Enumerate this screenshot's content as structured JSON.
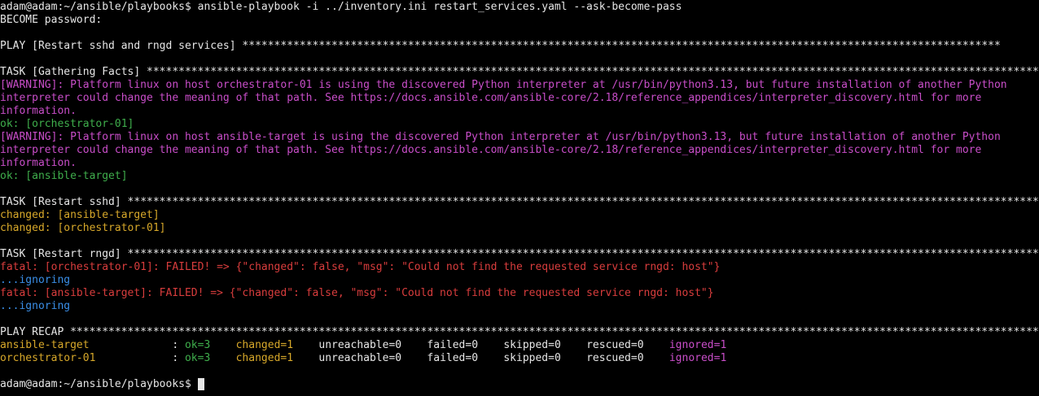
{
  "terminal": {
    "colors": {
      "background": "#000000",
      "default": "#e6e6e6",
      "warning": "#c94ec9",
      "ok": "#3fae4c",
      "changed": "#d7a82a",
      "fatal": "#d93d3d",
      "ignoring": "#3a8ee6"
    },
    "lines": [
      [
        {
          "t": "adam@adam:~/ansible/playbooks$ ansible-playbook -i ../inventory.ini restart_services.yaml --ask-become-pass",
          "c": "default"
        }
      ],
      [
        {
          "t": "BECOME password:",
          "c": "default"
        }
      ],
      [],
      [
        {
          "t": "PLAY [Restart sshd and rngd services] ",
          "c": "default"
        },
        {
          "t": "***********************************************************************************************************************",
          "c": "default"
        }
      ],
      [],
      [
        {
          "t": "TASK [Gathering Facts] ",
          "c": "default"
        },
        {
          "t": "*********************************************************************************************************************************************",
          "c": "default"
        }
      ],
      [
        {
          "t": "[WARNING]: Platform linux on host orchestrator-01 is using the discovered Python interpreter at /usr/bin/python3.13, but future installation of another Python",
          "c": "magenta"
        }
      ],
      [
        {
          "t": "interpreter could change the meaning of that path. See https://docs.ansible.com/ansible-core/2.18/reference_appendices/interpreter_discovery.html for more",
          "c": "magenta"
        }
      ],
      [
        {
          "t": "information.",
          "c": "magenta"
        }
      ],
      [
        {
          "t": "ok: [orchestrator-01]",
          "c": "green"
        }
      ],
      [
        {
          "t": "[WARNING]: Platform linux on host ansible-target is using the discovered Python interpreter at /usr/bin/python3.13, but future installation of another Python",
          "c": "magenta"
        }
      ],
      [
        {
          "t": "interpreter could change the meaning of that path. See https://docs.ansible.com/ansible-core/2.18/reference_appendices/interpreter_discovery.html for more",
          "c": "magenta"
        }
      ],
      [
        {
          "t": "information.",
          "c": "magenta"
        }
      ],
      [
        {
          "t": "ok: [ansible-target]",
          "c": "green"
        }
      ],
      [],
      [
        {
          "t": "TASK [Restart sshd] ",
          "c": "default"
        },
        {
          "t": "************************************************************************************************************************************************",
          "c": "default"
        }
      ],
      [
        {
          "t": "changed: [ansible-target]",
          "c": "yellow"
        }
      ],
      [
        {
          "t": "changed: [orchestrator-01]",
          "c": "yellow"
        }
      ],
      [],
      [
        {
          "t": "TASK [Restart rngd] ",
          "c": "default"
        },
        {
          "t": "************************************************************************************************************************************************",
          "c": "default"
        }
      ],
      [
        {
          "t": "fatal: [orchestrator-01]: FAILED! => {\"changed\": false, \"msg\": \"Could not find the requested service rngd: host\"}",
          "c": "red"
        }
      ],
      [
        {
          "t": "...ignoring",
          "c": "blue"
        }
      ],
      [
        {
          "t": "fatal: [ansible-target]: FAILED! => {\"changed\": false, \"msg\": \"Could not find the requested service rngd: host\"}",
          "c": "red"
        }
      ],
      [
        {
          "t": "...ignoring",
          "c": "blue"
        }
      ],
      [],
      [
        {
          "t": "PLAY RECAP ",
          "c": "default"
        },
        {
          "t": "*********************************************************************************************************************************************************",
          "c": "default"
        }
      ],
      [
        {
          "t": "ansible-target",
          "c": "yellow"
        },
        {
          "t": "             : ",
          "c": "default"
        },
        {
          "t": "ok=3",
          "c": "green"
        },
        {
          "t": "    ",
          "c": "default"
        },
        {
          "t": "changed=1",
          "c": "yellow"
        },
        {
          "t": "    unreachable=0    failed=0    skipped=0    rescued=0    ",
          "c": "default"
        },
        {
          "t": "ignored=1",
          "c": "magenta"
        }
      ],
      [
        {
          "t": "orchestrator-01",
          "c": "yellow"
        },
        {
          "t": "            : ",
          "c": "default"
        },
        {
          "t": "ok=3",
          "c": "green"
        },
        {
          "t": "    ",
          "c": "default"
        },
        {
          "t": "changed=1",
          "c": "yellow"
        },
        {
          "t": "    unreachable=0    failed=0    skipped=0    rescued=0    ",
          "c": "default"
        },
        {
          "t": "ignored=1",
          "c": "magenta"
        }
      ],
      [],
      [
        {
          "t": "adam@adam:~/ansible/playbooks$ ",
          "c": "default"
        },
        {
          "t": "",
          "c": "cursor"
        }
      ]
    ]
  }
}
